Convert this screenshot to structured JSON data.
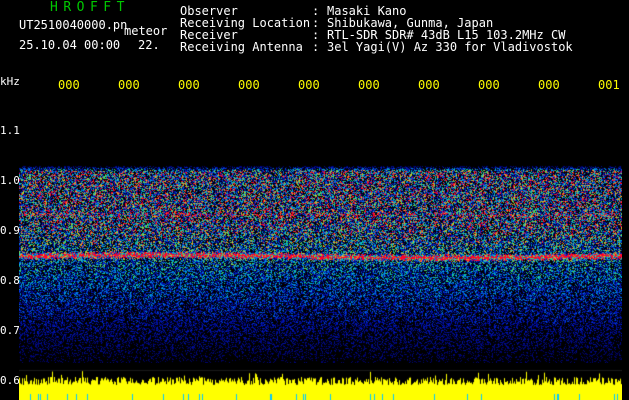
{
  "header": {
    "app_title": "HROFFT",
    "file_name": "UT2510040000.pn",
    "meteor_label": "meteor",
    "datetime": "25.10.04 00:00",
    "count": "22."
  },
  "info": [
    {
      "label": "Observer",
      "value": "Masaki Kano"
    },
    {
      "label": "Receiving Location",
      "value": "Shibukawa, Gunma, Japan"
    },
    {
      "label": "Receiver",
      "value": "RTL-SDR SDR# 43dB L15 103.2MHz CW"
    },
    {
      "label": "Receiving Antenna",
      "value": "3el Yagi(V) Az 330 for Vladivostok"
    }
  ],
  "info_colon": ":",
  "axis": {
    "unit": "kHz",
    "x_ticks": [
      "000",
      "000",
      "000",
      "000",
      "000",
      "000",
      "000",
      "000",
      "000",
      "001"
    ],
    "y_ticks": [
      "1.1",
      "1.0",
      "0.9",
      "0.8",
      "0.7",
      "0.6"
    ]
  },
  "colors": {
    "title_green": "#00c800",
    "tick_yellow": "#ffff00",
    "echo_band": "#ff2020",
    "noise_blue": "#1040c0"
  }
}
